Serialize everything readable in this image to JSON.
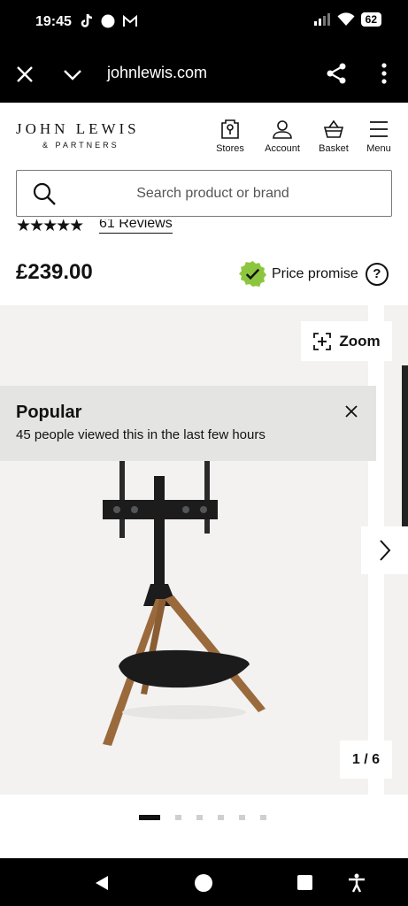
{
  "status_bar": {
    "time": "19:45",
    "battery": "62"
  },
  "browser": {
    "url": "johnlewis.com"
  },
  "header": {
    "logo_main": "JOHN LEWIS",
    "logo_sub": "& PARTNERS",
    "nav": [
      {
        "label": "Stores",
        "icon": "store-icon"
      },
      {
        "label": "Account",
        "icon": "account-icon"
      },
      {
        "label": "Basket",
        "icon": "basket-icon"
      },
      {
        "label": "Menu",
        "icon": "menu-icon"
      }
    ]
  },
  "search": {
    "placeholder": "Search product or brand"
  },
  "product": {
    "rating_stars": "★★★★★",
    "reviews_label": "61 Reviews",
    "price": "£239.00",
    "price_promise_label": "Price promise",
    "help_label": "?"
  },
  "gallery": {
    "zoom_label": "Zoom",
    "counter": "1 / 6",
    "total_images": 6,
    "current_image": 1
  },
  "popular_banner": {
    "title": "Popular",
    "text": "45 people viewed this in the last few hours"
  },
  "colors": {
    "accent_green": "#8cc63f",
    "text": "#121212",
    "gallery_bg": "#f3f2f1",
    "banner_bg": "#e4e4e3"
  }
}
